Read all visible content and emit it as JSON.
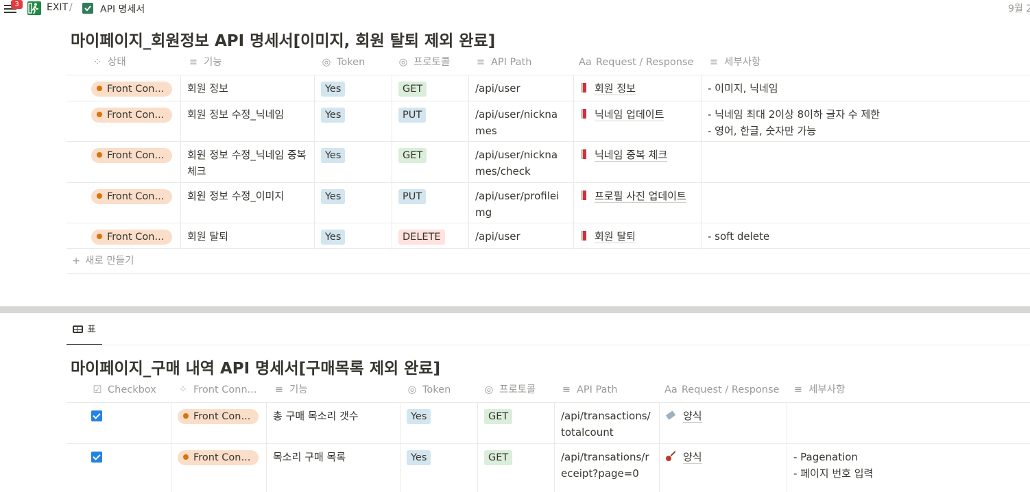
{
  "topbar": {
    "badge_count": "3",
    "crumb_exit": "EXIT",
    "crumb_sep": "/",
    "crumb_page": "API 명세서",
    "date_fragment": "9월 2"
  },
  "section1": {
    "title": "마이페이지_회원정보 API 명세서[이미지, 회원 탈퇴 제외 완료]",
    "headers": [
      "상태",
      "기능",
      "Token",
      "프로토콜",
      "API Path",
      "Request / Response",
      "세부사항"
    ],
    "rows": [
      {
        "status": "Front Con...",
        "feature": "회원 정보",
        "token": "Yes",
        "protocol": "GET",
        "path": "/api/user",
        "request": "회원 정보",
        "detail": [
          "- 이미지, 닉네임"
        ]
      },
      {
        "status": "Front Con...",
        "feature": "회원 정보 수정_닉네임",
        "token": "Yes",
        "protocol": "PUT",
        "path": "/api/user/nicknames",
        "request": "닉네임 업데이트",
        "detail": [
          "- 닉네임 최대 2이상 8이하 글자 수 제한",
          "- 영어, 한글, 숫자만 가능"
        ]
      },
      {
        "status": "Front Con...",
        "feature": "회원 정보 수정_닉네임 중복 체크",
        "token": "Yes",
        "protocol": "GET",
        "path": "/api/user/nicknames/check",
        "request": "닉네임 중복 체크",
        "detail": []
      },
      {
        "status": "Front Con...",
        "feature": "회원 정보 수정_이미지",
        "token": "Yes",
        "protocol": "PUT",
        "path": "/api/user/profileimg",
        "request": "프로필 사진 업데이트",
        "detail": []
      },
      {
        "status": "Front Con...",
        "feature": "회원 탈퇴",
        "token": "Yes",
        "protocol": "DELETE",
        "path": "/api/user",
        "request": "회원 탈퇴",
        "detail": [
          "- soft delete"
        ]
      }
    ],
    "new_label": "새로 만들기"
  },
  "view_tab": "표",
  "section2": {
    "title": "마이페이지_구매 내역 API 명세서[구매목록 제외 완료]",
    "headers": [
      "Checkbox",
      "Front Conn...",
      "기능",
      "Token",
      "프로토콜",
      "API Path",
      "Request / Response",
      "세부사항"
    ],
    "rows": [
      {
        "checked": true,
        "status": "Front Con...",
        "feature": "총 구매 목소리 갯수",
        "token": "Yes",
        "protocol": "GET",
        "path": "/api/transactions/totalcount",
        "request": "양식",
        "detail": []
      },
      {
        "checked": true,
        "status": "Front Con...",
        "feature": "목소리 구매 목록",
        "token": "Yes",
        "protocol": "GET",
        "path": "/api/transations/receipt?page=0",
        "request": "양식",
        "detail": [
          "- Pagenation",
          "- 페이지 번호 입력"
        ]
      }
    ]
  },
  "colors": {
    "status_bg": "#fadec9",
    "status_dot": "#d9730d",
    "tag_blue": "#d3e5ef",
    "tag_green": "#dbeddb",
    "tag_red": "#ffe2dd",
    "checkbox": "#2383e2"
  }
}
